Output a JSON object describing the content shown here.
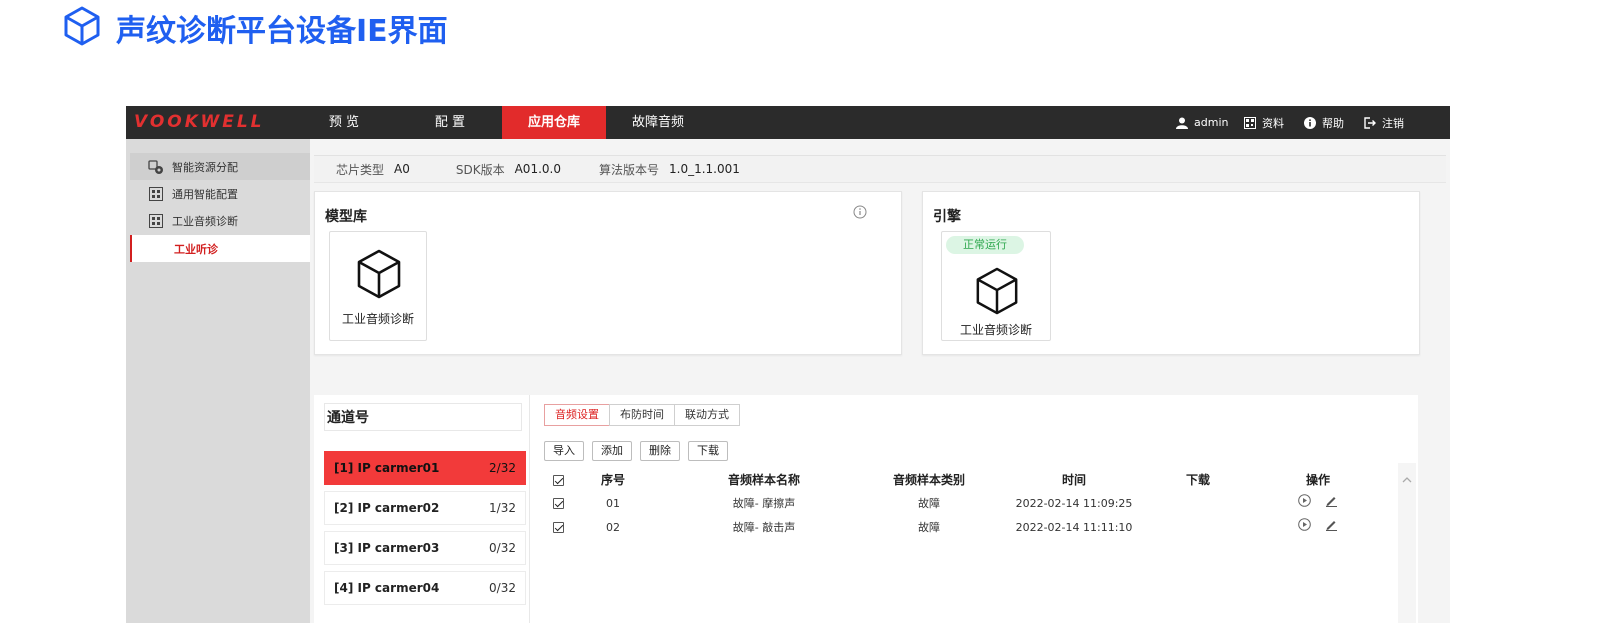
{
  "page": {
    "title": "声纹诊断平台设备IE界面"
  },
  "colors": {
    "accent": "#e22b2b",
    "title_blue": "#1f5ff0",
    "status_green": "#2fa84f"
  },
  "nav": {
    "logo": "VOOKWELL",
    "items": [
      {
        "label": "预 览"
      },
      {
        "label": "配 置"
      },
      {
        "label": "应用仓库",
        "active": true
      },
      {
        "label": "故障音频"
      }
    ],
    "user": {
      "icon": "user-icon",
      "label": "admin"
    },
    "links": [
      {
        "icon": "qr-icon",
        "label": "资料"
      },
      {
        "icon": "info-icon",
        "label": "帮助"
      },
      {
        "icon": "logout-icon",
        "label": "注销"
      }
    ]
  },
  "sidebar": {
    "items": [
      {
        "label": "智能资源分配",
        "icon": "resource-icon"
      },
      {
        "label": "通用智能配置",
        "icon": "grid-icon"
      },
      {
        "label": "工业音频诊断",
        "icon": "grid-icon"
      },
      {
        "label": "工业听诊",
        "sub": true
      }
    ]
  },
  "info": {
    "chip_label": "芯片类型",
    "chip_value": "A0",
    "sdk_label": "SDK版本",
    "sdk_value": "A01.0.0",
    "algo_label": "算法版本号",
    "algo_value": "1.0_1.1.001"
  },
  "model_lib": {
    "title": "模型库",
    "card_label": "工业音频诊断"
  },
  "engine": {
    "title": "引擎",
    "status": "正常运行",
    "card_label": "工业音频诊断"
  },
  "channels": {
    "title": "通道号",
    "items": [
      {
        "name": "[1] IP carmer01",
        "count": "2/32",
        "active": true
      },
      {
        "name": "[2] IP carmer02",
        "count": "1/32"
      },
      {
        "name": "[3] IP carmer03",
        "count": "0/32"
      },
      {
        "name": "[4] IP carmer04",
        "count": "0/32"
      }
    ]
  },
  "audio": {
    "tabs": [
      "音频设置",
      "布防时间",
      "联动方式"
    ],
    "buttons": [
      "导入",
      "添加",
      "删除",
      "下载"
    ],
    "columns": [
      "序号",
      "音频样本名称",
      "音频样本类别",
      "时间",
      "下载",
      "操作"
    ],
    "rows": [
      {
        "no": "01",
        "name": "故障- 摩擦声",
        "type": "故障",
        "time": "2022-02-14 11:09:25"
      },
      {
        "no": "02",
        "name": "故障- 敲击声",
        "type": "故障",
        "time": "2022-02-14 11:11:10"
      }
    ]
  }
}
